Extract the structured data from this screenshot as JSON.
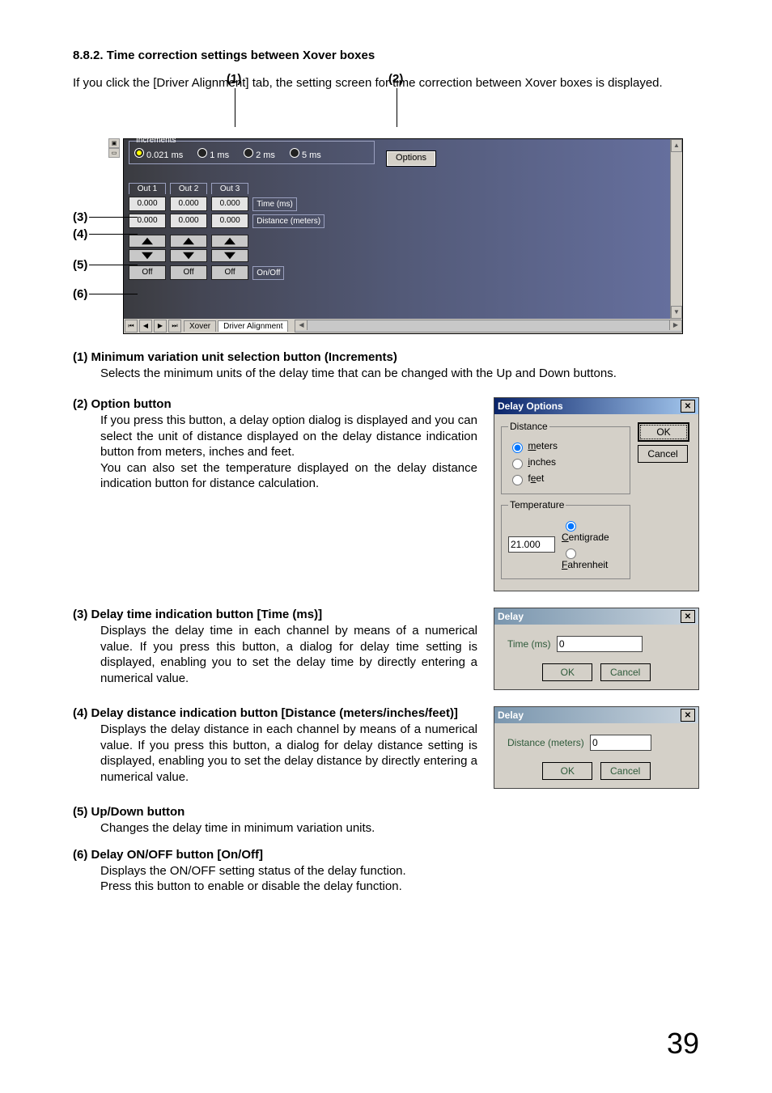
{
  "headings": {
    "section_number": "8.8.2. Time correction settings between Xover boxes"
  },
  "intro": "If you click the [Driver Alignment] tab, the setting screen for time correction between Xover boxes is displayed.",
  "annotations": {
    "one": "(1)",
    "two": "(2)",
    "three": "(3)",
    "four": "(4)",
    "five": "(5)",
    "six": "(6)"
  },
  "screenshot": {
    "increments_label": "Increments",
    "radios": {
      "r1": "0.021 ms",
      "r2": "1 ms",
      "r3": "2 ms",
      "r4": "5 ms"
    },
    "options_button": "Options",
    "out_headers": {
      "o1": "Out 1",
      "o2": "Out 2",
      "o3": "Out 3"
    },
    "time_row_label": "Time (ms)",
    "dist_row_label": "Distance (meters)",
    "cell_value": "0.000",
    "off_label": "Off",
    "onoff_label": "On/Off",
    "tabs": {
      "xover": "Xover",
      "driver": "Driver Alignment"
    }
  },
  "items": {
    "i1_title": "(1) Minimum variation unit selection button (Increments)",
    "i1_body": "Selects the minimum units of the delay time that can be changed with the Up and Down buttons.",
    "i2_title": "(2) Option button",
    "i2_body1": "If you press this button, a delay option dialog is displayed and you can select the unit of distance displayed on the delay distance indication button from meters, inches and feet.",
    "i2_body2": "You can also set the temperature displayed on the delay distance indication button for distance calculation.",
    "i3_title": "(3) Delay time indication button [Time (ms)]",
    "i3_body": "Displays the delay time in each channel by means of a numerical value. If you press this button, a dialog for delay time setting is displayed, enabling you to set the delay time by directly entering a numerical value.",
    "i4_title": "(4) Delay distance indication button [Distance (meters/inches/feet)]",
    "i4_body": "Displays the delay distance in each channel by means of a numerical value. If you press this button, a dialog for delay distance setting is displayed, enabling you to set the delay distance by directly entering a numerical value.",
    "i5_title": "(5) Up/Down button",
    "i5_body": "Changes the delay time in minimum variation units.",
    "i6_title": "(6) Delay ON/OFF button [On/Off]",
    "i6_body1": "Displays the ON/OFF setting status of the delay function.",
    "i6_body2": "Press this button to enable or disable the delay function."
  },
  "delay_options_dialog": {
    "title": "Delay Options",
    "distance_legend": "Distance",
    "meters": "meters",
    "inches": "inches",
    "feet": "feet",
    "temperature_legend": "Temperature",
    "temp_value": "21.000",
    "centigrade": "Centigrade",
    "fahrenheit": "Fahrenheit",
    "ok": "OK",
    "cancel": "Cancel"
  },
  "delay_time_dialog": {
    "title": "Delay",
    "label": "Time (ms)",
    "value": "0",
    "ok": "OK",
    "cancel": "Cancel"
  },
  "delay_dist_dialog": {
    "title": "Delay",
    "label": "Distance (meters)",
    "value": "0",
    "ok": "OK",
    "cancel": "Cancel"
  },
  "page_number": "39"
}
